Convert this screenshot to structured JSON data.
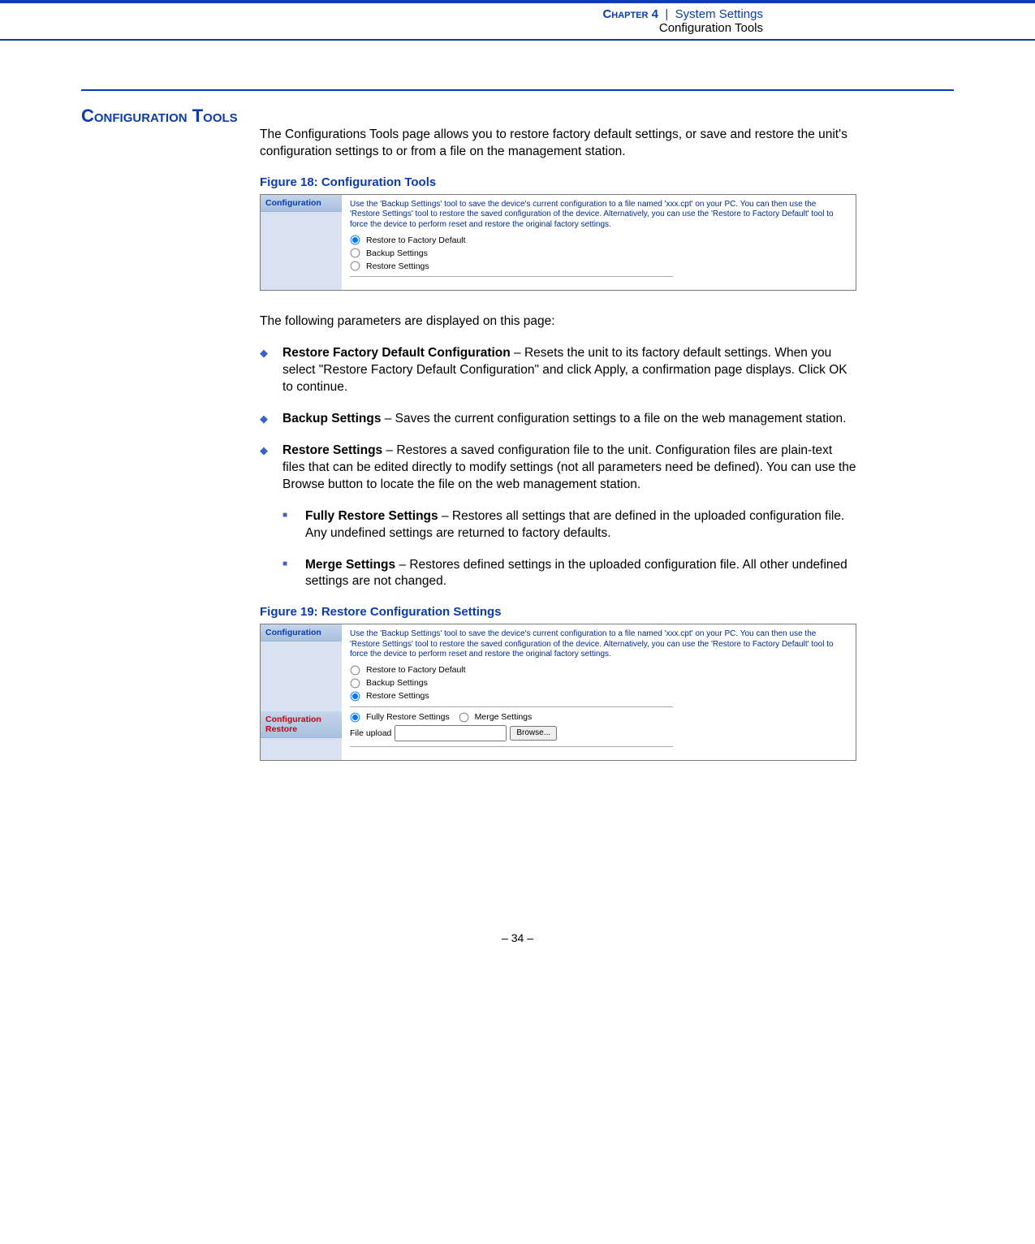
{
  "header": {
    "chapter": "Chapter 4",
    "separator": "|",
    "section": "System Settings",
    "subsection": "Configuration Tools"
  },
  "section_title": "Configuration Tools",
  "intro_paragraph": "The Configurations Tools page allows you to restore factory default settings, or save and restore the unit's configuration settings to or from a file on the management station.",
  "figure18": {
    "label": "Figure 18:  Configuration Tools",
    "sidebar_label": "Configuration",
    "help_text": "Use the 'Backup Settings' tool to save the device's current configuration to a file named 'xxx.cpt' on your PC. You can then use the 'Restore Settings' tool to restore the saved configuration of the device. Alternatively, you can use the 'Restore to Factory Default' tool to force the device to perform reset and restore the original factory settings.",
    "options": {
      "restore_default": "Restore to Factory Default",
      "backup": "Backup Settings",
      "restore": "Restore Settings"
    }
  },
  "params_intro": "The following parameters are displayed on this page:",
  "bullets": {
    "restore_factory": {
      "bold": "Restore Factory Default Configuration",
      "text": " – Resets the unit to its factory default settings. When you select \"Restore Factory Default Configuration\" and click Apply, a confirmation page displays. Click OK to continue."
    },
    "backup": {
      "bold": "Backup Settings",
      "text": " – Saves the current configuration settings to a file on the web management station."
    },
    "restore": {
      "bold": "Restore Settings",
      "text": " – Restores a saved configuration file to the unit. Configuration files are plain-text files that can be edited directly to modify settings (not all parameters need be defined). You can use the Browse button to locate the file on the web management station."
    },
    "fully": {
      "bold": "Fully Restore Settings",
      "text": " – Restores all settings that are defined in the uploaded configuration file. Any undefined settings are returned to factory defaults."
    },
    "merge": {
      "bold": "Merge Settings",
      "text": " – Restores defined settings in the uploaded configuration file. All other undefined settings are not changed."
    }
  },
  "figure19": {
    "label": "Figure 19:  Restore Configuration Settings",
    "sidebar_config": "Configuration",
    "sidebar_restore": "Configuration Restore",
    "help_text": "Use the 'Backup Settings' tool to save the device's current configuration to a file named 'xxx.cpt' on your PC. You can then use the 'Restore Settings' tool to restore the saved configuration of the device. Alternatively, you can use the 'Restore to Factory Default' tool to force the device to perform reset and restore the original factory settings.",
    "options": {
      "restore_default": "Restore to Factory Default",
      "backup": "Backup Settings",
      "restore": "Restore Settings",
      "fully": "Fully Restore Settings",
      "merge": "Merge Settings",
      "file_upload_label": "File upload",
      "browse_button": "Browse..."
    }
  },
  "page_number": "–  34  –"
}
